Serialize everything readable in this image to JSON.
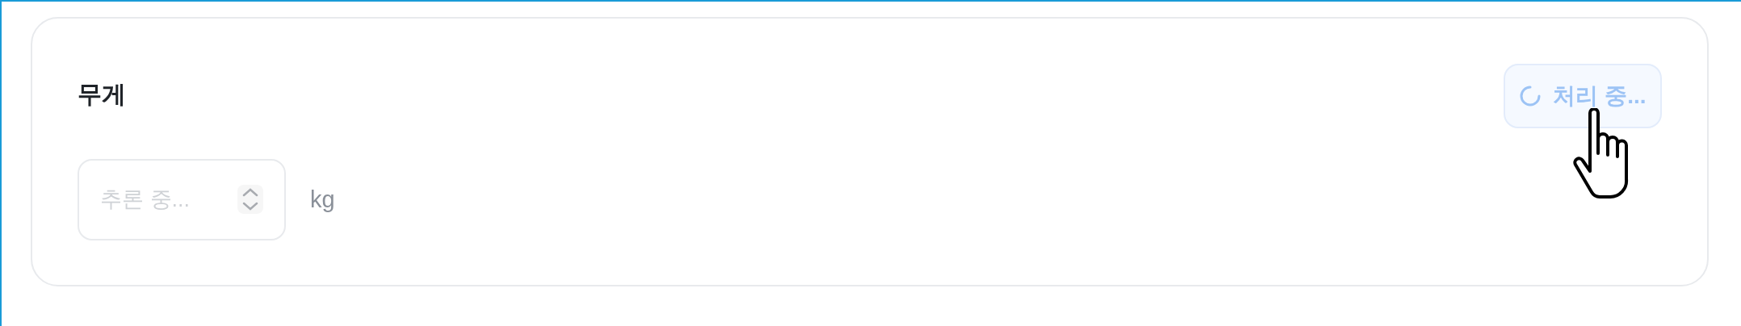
{
  "card": {
    "title": "무게",
    "button": {
      "label": "처리 중...",
      "loading": true,
      "disabled": true
    },
    "field": {
      "placeholder": "추론 중...",
      "disabled": true
    },
    "unit": "kg"
  }
}
